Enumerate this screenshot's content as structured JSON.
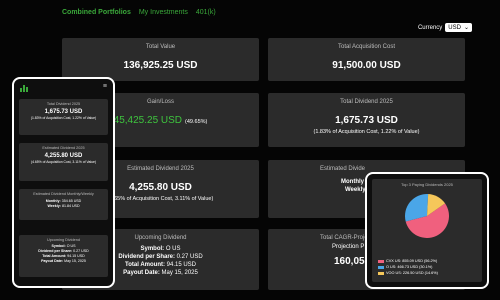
{
  "nav": {
    "brand": "Combined Portfolios",
    "links": [
      "My Investments",
      "401(k)"
    ]
  },
  "currency": {
    "label": "Currency",
    "selected": "USD"
  },
  "cards": {
    "total_value": {
      "title": "Total Value",
      "value": "136,925.25 USD"
    },
    "total_acq": {
      "title": "Total Acquisition Cost",
      "value": "91,500.00 USD"
    },
    "gain_loss": {
      "title": "Gain/Loss",
      "value": "45,425.25 USD",
      "pct": "(49.65%)"
    },
    "total_div": {
      "title": "Total Dividend 2025",
      "value": "1,675.73 USD",
      "sub": "(1.83% of Acquisition Cost, 1.22% of Value)"
    },
    "est_div": {
      "title": "Estimated Dividend 2025",
      "value": "4,255.80 USD",
      "sub": "(4.65% of Acquisition Cost, 3.11% of Value)"
    },
    "est_div_right": {
      "title": "Estimated Divide",
      "line1": "Monthly",
      "line2": "Weekly"
    },
    "upcoming": {
      "title": "Upcoming Dividend",
      "symbol_label": "Symbol:",
      "symbol": "O US",
      "per_share_label": "Dividend per Share:",
      "per_share": "0.27 USD",
      "amount_label": "Total Amount:",
      "amount": "94.15 USD",
      "date_label": "Payout Date:",
      "date": "May 15, 2025"
    },
    "cagr": {
      "title": "Total CAGR-Proje",
      "sub": "Projection P",
      "value": "160,05"
    }
  },
  "mobile": {
    "menu_icon": "hamburger-icon",
    "total_div": {
      "title": "Total Dividend 2025",
      "value": "1,675.73 USD",
      "sub": "(1.83% of Acquisition Cost, 1.22% of Value)"
    },
    "est_div": {
      "title": "Estimated Dividend 2025",
      "value": "4,255.80 USD",
      "sub": "(4.65% of Acquisition Cost, 3.11% of Value)"
    },
    "est_monthly": {
      "title": "Estimated Dividend Monthly/Weekly",
      "monthly_label": "Monthly:",
      "monthly": "354.65 USD",
      "weekly_label": "Weekly:",
      "weekly": "81.84 USD"
    },
    "upcoming": {
      "title": "Upcoming Dividend",
      "symbol_label": "Symbol:",
      "symbol": "O US",
      "per_share_label": "Dividend per Share:",
      "per_share": "0.27 USD",
      "amount_label": "Total Amount:",
      "amount": "94.15 USD",
      "date_label": "Payout Date:",
      "date": "May 15, 2025"
    }
  },
  "chart_data": {
    "type": "pie",
    "title": "Top 3 Paying Dividends 2025",
    "slices": [
      {
        "label": "CVX US: 855.09 USD (56.2%)",
        "value": 56.2,
        "color": "#f0607e"
      },
      {
        "label": "O US: 466.73 USD (30.1%)",
        "value": 30.1,
        "color": "#4aa6e8"
      },
      {
        "label": "VOO US: 226.50 USD (14.6%)",
        "value": 14.6,
        "color": "#f5c75a"
      }
    ]
  }
}
